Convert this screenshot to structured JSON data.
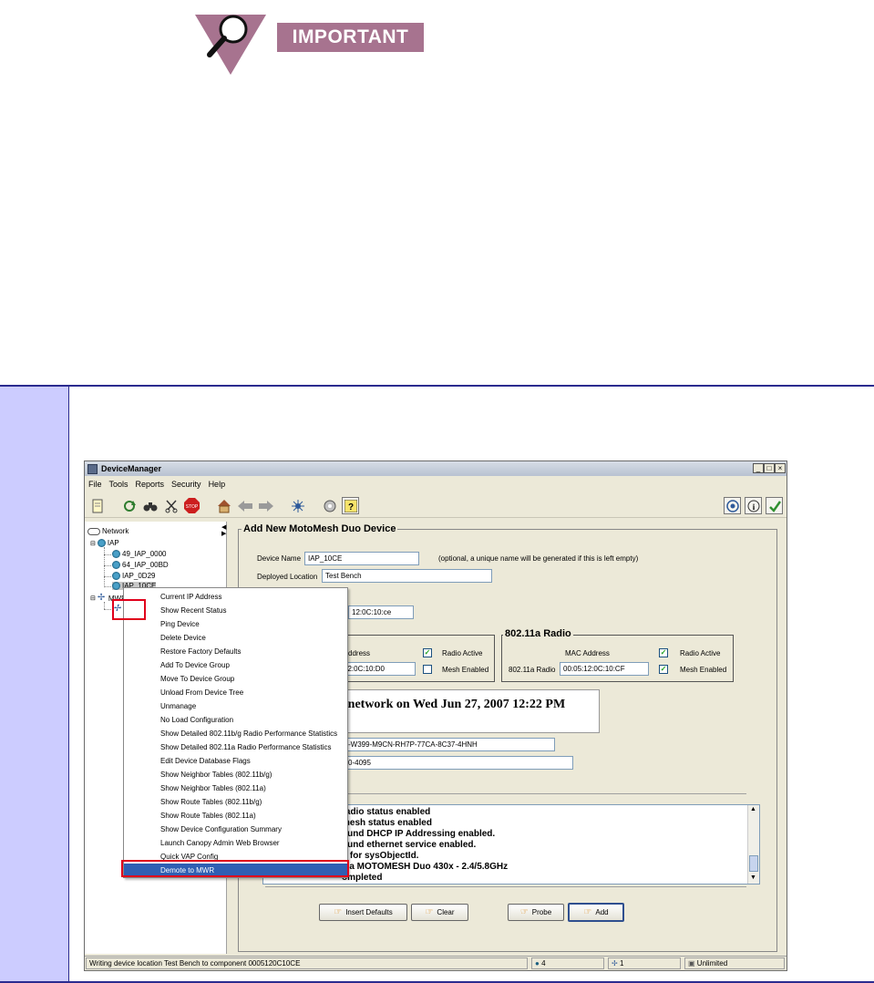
{
  "header": {
    "badge_text": "IMPORTANT"
  },
  "window": {
    "title": "DeviceManager",
    "controls": {
      "minimize": "_",
      "maximize": "□",
      "close": "×"
    }
  },
  "menubar": {
    "items": [
      "File",
      "Tools",
      "Reports",
      "Security",
      "Help"
    ]
  },
  "toolbar": {
    "icons": [
      "new-device-icon",
      "refresh-icon",
      "binoculars-icon",
      "cut-icon",
      "stop-icon",
      "home-icon",
      "back-arrow-icon",
      "forward-arrow-icon",
      "network-ping-icon",
      "disk-icon",
      "help-icon",
      "target-icon",
      "info-icon",
      "checkmark-icon"
    ],
    "stop_label": "STOP",
    "help_label": "?",
    "info_label": "i"
  },
  "tree": {
    "root": "Network",
    "iap_group": "IAP",
    "iap_nodes": [
      "49_IAP_0000",
      "64_IAP_00BD",
      "IAP_0D29",
      "IAP_10CE"
    ],
    "mwr_group": "MWR",
    "mwr_node": "WR"
  },
  "context_menu": {
    "items": [
      "Current IP Address",
      "Show Recent Status",
      "Ping Device",
      "Delete Device",
      "Restore Factory Defaults",
      "Add To Device Group",
      "Move To Device Group",
      "Unload From Device Tree",
      "Unmanage",
      "No Load Configuration",
      "Show Detailed 802.11b/g Radio Performance Statistics",
      "Show Detailed 802.11a Radio Performance Statistics",
      "Edit Device Database Flags",
      "Show Neighbor Tables (802.11b/g)",
      "Show Neighbor Tables (802.11a)",
      "Show Route Tables (802.11b/g)",
      "Show Route Tables (802.11a)",
      "Show Device Configuration Summary",
      "Launch Canopy Admin Web Browser",
      "Quick VAP Config",
      "Demote to MWR"
    ],
    "selected": "Demote to MWR"
  },
  "form": {
    "title": "Add New MotoMesh Duo Device",
    "device_name_label": "Device Name",
    "device_name_value": "IAP_10CE",
    "device_name_hint": "(optional, a unique name will be generated if this is left empty)",
    "location_label": "Deployed Location",
    "location_value": "Test Bench",
    "mac_partial": "12:0C:10:ce",
    "radio_a": {
      "title": "802.11a Radio",
      "mac_label": "MAC Address",
      "radio_label": "802.11a Radio",
      "mac_value": "00:05:12:0C:10:CF",
      "active_label": "Radio Active",
      "active_mark": "✓",
      "mesh_label": "Mesh Enabled",
      "mesh_mark": "✓"
    },
    "radio_bg": {
      "mac_label_partial": "ddress",
      "mac_value_partial": "12:0C:10:D0",
      "active_label": "Radio Active",
      "active_mark": "✓",
      "mesh_label": "Mesh Enabled",
      "mesh_mark": ""
    },
    "connected_text": "ed to network on Wed Jun 27, 2007 12:22 PM",
    "license_partial": "-W399-M9CN-RH7P-77CA-8C37-4HNH",
    "serial_partial": "0-4095",
    "log_lines": [
      "radio status enabled",
      "mesh status enabled",
      "ound DHCP IP Addressing enabled.",
      "ound ethernet service enabled.",
      "g for sysObjectId.",
      "s a MOTOMESH Duo 430x - 2.4/5.8GHz",
      "ompleted"
    ],
    "buttons": {
      "insert_defaults": "Insert Defaults",
      "clear": "Clear",
      "probe": "Probe",
      "add": "Add"
    }
  },
  "statusbar": {
    "message": "Writing device location Test Bench to component 0005120C10CE",
    "iap_count": "4",
    "mwr_count": "1",
    "license": "Unlimited"
  },
  "colors": {
    "note_sidebar": "#ccccff",
    "highlight": "#e0001b",
    "badge": "#a7738f",
    "selection": "#2f5fb3"
  }
}
